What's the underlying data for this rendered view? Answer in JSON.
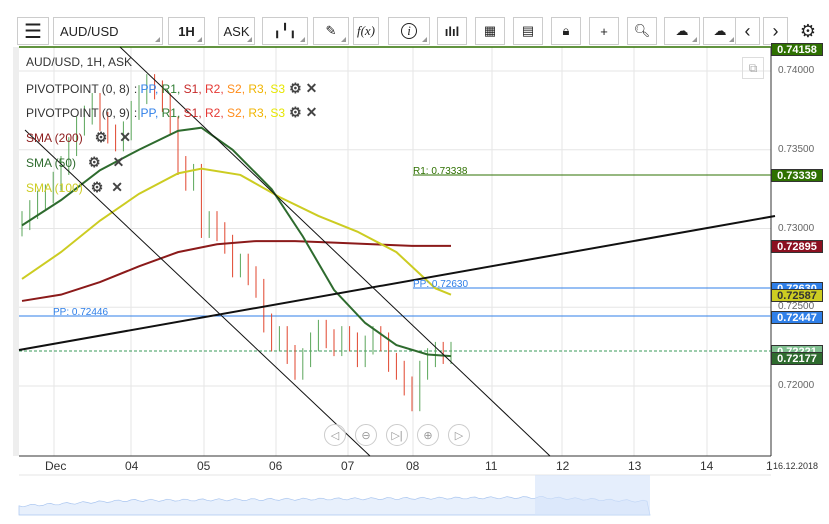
{
  "toolbar": {
    "symbol": "AUD/USD",
    "timeframe": "1H",
    "price_type": "ASK",
    "fx_label": "f(x)",
    "icons": [
      "menu-icon",
      "candles-icon",
      "pencil-icon",
      "function-icon",
      "info-icon",
      "volume-bars-icon",
      "calendar-icon",
      "news-icon",
      "lock-icon",
      "crosshair-icon",
      "zoom-icon",
      "upload-icon",
      "download-icon",
      "prev-icon",
      "next-icon",
      "gear-icon"
    ]
  },
  "legend": {
    "title": "AUD/USD, 1H, ASK",
    "pivots": [
      {
        "name": "PIVOTPOINT (0, 8)"
      },
      {
        "name": "PIVOTPOINT (0, 9)"
      }
    ],
    "pivot_sep": ":",
    "pivot_items": [
      {
        "t": "PP",
        "c": "#2f7fe8"
      },
      {
        "t": "R1",
        "c": "#2e7d32"
      },
      {
        "t": "S1",
        "c": "#c62828"
      },
      {
        "t": "R2",
        "c": "#e53935"
      },
      {
        "t": "S2",
        "c": "#ff8c1a"
      },
      {
        "t": "R3",
        "c": "#f0b400"
      },
      {
        "t": "S3",
        "c": "#e6e600"
      }
    ],
    "smas": [
      {
        "name": "SMA (200)",
        "color": "#8b1a1a"
      },
      {
        "name": "SMA (50)",
        "color": "#2e6b2e"
      },
      {
        "name": "SMA (100)",
        "color": "#cccc22"
      }
    ]
  },
  "chart_data": {
    "type": "candlestick",
    "symbol": "AUD/USD",
    "interval": "1H",
    "ylim": [
      0.7175,
      0.742
    ],
    "y_ticks": [
      "0.74000",
      "0.73500",
      "0.73000",
      "0.72500",
      "0.72000"
    ],
    "x_ticks": [
      "Dec",
      "04",
      "05",
      "06",
      "07",
      "08",
      "11",
      "12",
      "13",
      "14",
      "1",
      "16.12.2018"
    ],
    "closes": [
      0.7305,
      0.7312,
      0.7318,
      0.7322,
      0.733,
      0.734,
      0.7352,
      0.7365,
      0.7372,
      0.738,
      0.7368,
      0.736,
      0.7355,
      0.7362,
      0.7375,
      0.7385,
      0.7392,
      0.7388,
      0.738,
      0.7365,
      0.734,
      0.733,
      0.7335,
      0.73,
      0.7305,
      0.7298,
      0.729,
      0.7275,
      0.7278,
      0.727,
      0.7262,
      0.724,
      0.7228,
      0.7232,
      0.722,
      0.721,
      0.7218,
      0.7228,
      0.7236,
      0.723,
      0.7225,
      0.7232,
      0.7228,
      0.7218,
      0.7226,
      0.7232,
      0.7228,
      0.7215,
      0.721,
      0.72,
      0.719,
      0.721,
      0.7218,
      0.7222,
      0.722,
      0.7222
    ],
    "sma200": [
      [
        0,
        0.7254
      ],
      [
        5,
        0.7258
      ],
      [
        10,
        0.7266
      ],
      [
        15,
        0.7276
      ],
      [
        20,
        0.7285
      ],
      [
        25,
        0.729
      ],
      [
        30,
        0.7292
      ],
      [
        35,
        0.7292
      ],
      [
        40,
        0.7291
      ],
      [
        45,
        0.729
      ],
      [
        50,
        0.7289
      ],
      [
        55,
        0.7289
      ]
    ],
    "sma100": [
      [
        0,
        0.7268
      ],
      [
        5,
        0.7285
      ],
      [
        10,
        0.7305
      ],
      [
        15,
        0.7322
      ],
      [
        20,
        0.7335
      ],
      [
        23,
        0.7338
      ],
      [
        28,
        0.7334
      ],
      [
        33,
        0.732
      ],
      [
        38,
        0.7308
      ],
      [
        43,
        0.7298
      ],
      [
        48,
        0.7285
      ],
      [
        53,
        0.7262
      ],
      [
        55,
        0.7258
      ]
    ],
    "sma50": [
      [
        0,
        0.7302
      ],
      [
        5,
        0.7318
      ],
      [
        10,
        0.7337
      ],
      [
        15,
        0.735
      ],
      [
        20,
        0.7362
      ],
      [
        23,
        0.7364
      ],
      [
        27,
        0.735
      ],
      [
        32,
        0.7325
      ],
      [
        36,
        0.7295
      ],
      [
        40,
        0.7261
      ],
      [
        44,
        0.724
      ],
      [
        48,
        0.7226
      ],
      [
        52,
        0.722
      ],
      [
        55,
        0.7219
      ]
    ],
    "annotations": {
      "r1": "R1: 0.73338",
      "pp2": "PP: 0.72630",
      "pp1": "PP: 0.72446"
    },
    "price_labels": [
      {
        "v": "0.74158",
        "bg": "#2e7000",
        "fg": "#fff"
      },
      {
        "v": "0.73339",
        "bg": "#2e7000",
        "fg": "#fff"
      },
      {
        "v": "0.72895",
        "bg": "#8b1020",
        "fg": "#fff"
      },
      {
        "v": "0.72630",
        "bg": "#2f7fe8",
        "fg": "#fff"
      },
      {
        "v": "0.72587",
        "bg": "#cccc22",
        "fg": "#333"
      },
      {
        "v": "0.72447",
        "bg": "#2f7fe8",
        "fg": "#fff"
      },
      {
        "v": "0.72221",
        "bg": "#7fbf8f",
        "fg": "#fff"
      },
      {
        "v": "0.72177",
        "bg": "#2e6b2e",
        "fg": "#fff"
      }
    ]
  }
}
